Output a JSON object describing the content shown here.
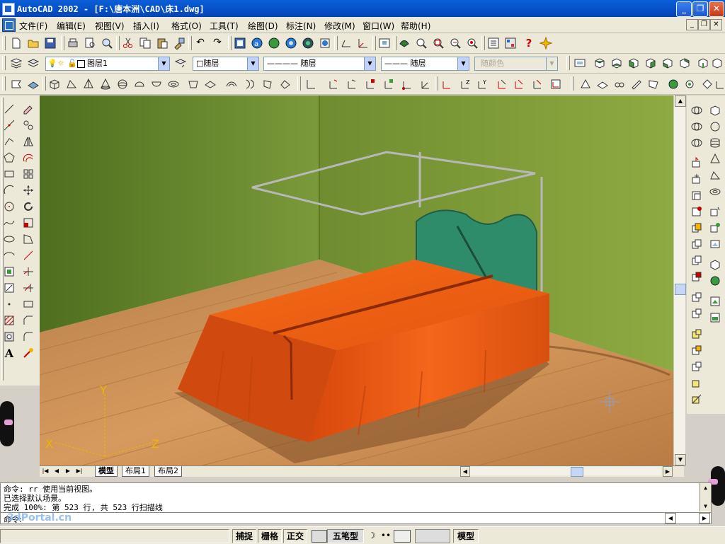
{
  "window": {
    "title": "AutoCAD 2002 - [F:\\唐本洲\\CAD\\床1.dwg]"
  },
  "title_buttons": {
    "minimize": "_",
    "restore": "❐",
    "close": "✕"
  },
  "menu": {
    "items": [
      "文件(F)",
      "编辑(E)",
      "视图(V)",
      "插入(I)",
      "格式(O)",
      "工具(T)",
      "绘图(D)",
      "标注(N)",
      "修改(M)",
      "窗口(W)",
      "帮助(H)"
    ]
  },
  "layers_toolbar": {
    "layer_name": "图层1",
    "color_value": "□随层",
    "linetype_value": "———— 随层",
    "lineweight_value": "——— 随层",
    "plotstyle_value": "随颜色"
  },
  "layout_tabs": {
    "items": [
      "模型",
      "布局1",
      "布局2"
    ],
    "active": "模型"
  },
  "axis_icon": {
    "x": "X",
    "y": "Y",
    "z": "Z"
  },
  "command": {
    "lines": [
      "命令: rr 使用当前视图。",
      "已选择默认场景。",
      "完成 100%: 第 523 行, 共 523 行扫描线"
    ],
    "prompt": "命令:"
  },
  "status_bar": {
    "snap": "捕捉",
    "grid": "栅格",
    "ortho": "正交",
    "ime": "五笔型",
    "model": "模型"
  },
  "watermark": {
    "text": "3dPortal.cn"
  },
  "colors": {
    "titlebar": "#0a5fd8",
    "wall_left": "#6e8f30",
    "wall_back": "#7c9a38",
    "floor": "#c98e55",
    "bedspread": "#e85a14",
    "headboard": "#2f8c6a"
  }
}
